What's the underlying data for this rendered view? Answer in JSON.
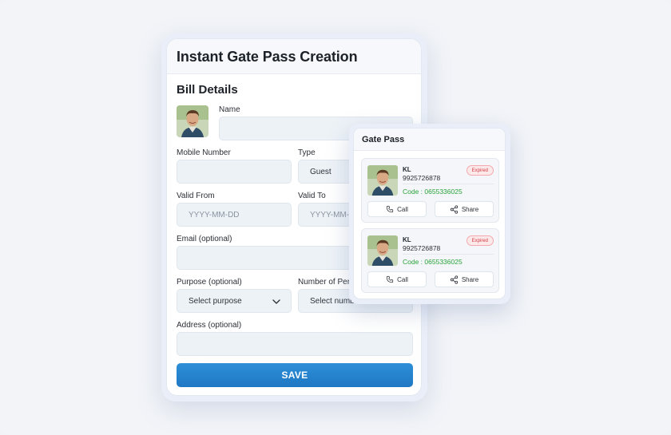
{
  "form": {
    "title": "Instant Gate Pass Creation",
    "section": "Bill Details",
    "name_label": "Name",
    "name_value": "",
    "mobile_label": "Mobile Number",
    "mobile_value": "",
    "type_label": "Type",
    "type_value": "Guest",
    "valid_from_label": "Valid From",
    "valid_from_placeholder": "YYYY-MM-DD",
    "valid_to_label": "Valid To",
    "valid_to_placeholder": "YYYY-MM-",
    "email_label": "Email (optional)",
    "email_value": "",
    "purpose_label": "Purpose (optional)",
    "purpose_placeholder": "Select purpose",
    "persons_label": "Number of Per",
    "persons_placeholder": "Select numb",
    "address_label": "Address (optional)",
    "address_value": "",
    "save_label": "SAVE"
  },
  "gate_pass": {
    "title": "Gate Pass",
    "passes": [
      {
        "name": "KL",
        "phone": "9925726878",
        "code": "Code : 0655336025",
        "status": "Expired",
        "call_label": "Call",
        "share_label": "Share"
      },
      {
        "name": "KL",
        "phone": "9925726878",
        "code": "Code : 0655336025",
        "status": "Expired",
        "call_label": "Call",
        "share_label": "Share"
      }
    ]
  },
  "colors": {
    "accent": "#1f78c4",
    "code_green": "#2aa23a",
    "expired_red": "#d23a44"
  },
  "icons": [
    "person-avatar",
    "chevron-down-icon",
    "phone-icon",
    "share-icon"
  ]
}
